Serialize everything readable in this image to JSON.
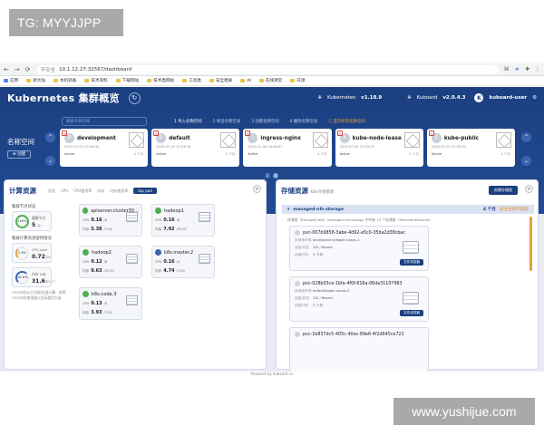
{
  "watermarks": {
    "top": "TG: MYYJJPP",
    "bottom": "www.yushijue.com"
  },
  "browser": {
    "insecure_label": "不安全",
    "url": "10.1.12.27:32567/dashboard",
    "bookmarks": [
      "应用",
      "新大陆",
      "本机装备",
      "技术资料",
      "下载网站",
      "技术类网站",
      "工具类",
      "安全相关",
      "AI",
      "在线课堂",
      "开源"
    ]
  },
  "app": {
    "title": "Kubernetes 集群概览",
    "kubernetes_label": "Kubernetes",
    "kubernetes_version": "v1.18.9",
    "kuboard_label": "Kuboard",
    "kuboard_version": "v2.0.4.3",
    "avatar_letter": "K",
    "user": "kuboard-user"
  },
  "toolbar": {
    "search_placeholder": "搜索名称空间",
    "steps": [
      "1 导入名称空间",
      "2 导出名称空间",
      "3 创建名称空间",
      "4 删除名称空间"
    ],
    "show_all": "显示所有名称空间"
  },
  "namespace": {
    "label": "名称空间",
    "new_button": "创建",
    "items": [
      {
        "letter": "D",
        "name": "development",
        "date": "2020-07-09 13:18:34",
        "status": "Active",
        "age": "4 个月"
      },
      {
        "letter": "D",
        "name": "default",
        "date": "2020-07-09 12:53:34",
        "status": "Active",
        "age": "4 个月"
      },
      {
        "letter": "I",
        "name": "ingress-nginx",
        "date": "2020-11-06 10:46:07",
        "status": "Active",
        "age": "4 个月"
      },
      {
        "letter": "K",
        "name": "kube-node-lease",
        "date": "2020-07-09 12:53:33",
        "status": "Active",
        "age": "4 个月"
      },
      {
        "letter": "K",
        "name": "kube-public",
        "date": "2020-07-09 12:53:33",
        "status": "Active",
        "age": "4 个月"
      }
    ],
    "pages": [
      "1",
      "2"
    ]
  },
  "compute": {
    "title": "计算资源",
    "tabs": [
      "总览",
      "CPU",
      "CPU使用率",
      "内存",
      "内存使用率",
      "top pod"
    ],
    "node_status_label": "集群节点状态",
    "alloc_label": "集群计算资源使用情况",
    "health": {
      "ring": "100%",
      "title": "健康节点",
      "value": "5",
      "unit": "台"
    },
    "cpu": {
      "ring": "2.6%",
      "title": "CPU core",
      "value": "0.72",
      "unit": "/28"
    },
    "mem": {
      "ring": "16.6%",
      "title": "内存 GiB",
      "value": "31.6",
      "unit": "/63.77"
    },
    "notes": [
      "CPU/内存以已分配/总量计算 · 说明",
      "CPU/内存使用量以实际使用为准"
    ],
    "cpu_label": "CPU",
    "mem_label": "内存",
    "nodes": [
      {
        "name": "apiserver.cluster30…",
        "cpu": "0.16",
        "cpu_total": "/4",
        "mem": "5.38",
        "mem_total": "/7.54"
      },
      {
        "name": "hadoop1",
        "cpu": "0.16",
        "cpu_total": "/8",
        "mem": "7.92",
        "mem_total": "/15.07"
      },
      {
        "name": "hadoop2",
        "cpu": "0.12",
        "cpu_total": "/8",
        "mem": "9.63",
        "mem_total": "/15.07"
      },
      {
        "name": "k8s.master.2",
        "cpu": "0.16",
        "cpu_total": "/4",
        "mem": "4.74",
        "mem_total": "/7.54"
      },
      {
        "name": "k8s.node.3",
        "cpu": "0.13",
        "cpu_total": "/4",
        "mem": "3.93",
        "mem_total": "/7.54"
      }
    ]
  },
  "storage": {
    "title": "存储资源",
    "subtitle": "K8s存储管理",
    "manage_button": "创建存储类",
    "class_name": "managed-nfs-storage",
    "class_count": "4 个月",
    "class_link": "前往查看存储类",
    "class_desc": "存储类（StorageClass）managed-nfs-storage 中共有 10 个存储卷（PersistentVolume）",
    "name_label": "存储卷声明",
    "cap_label": "容量/状态",
    "age_label": "创建时间",
    "btn_label": "文件浏览器",
    "pvcs": [
      {
        "name": "pvc-007b9858-3abe-4d92-a5c0-35ba2d38cbac",
        "ns": "development/logdir-nacos-1",
        "cap": "1Gi / Bound",
        "age": "3 个月"
      },
      {
        "name": "pvc-028b03ce-1bfa-4f0f-816a-06da31107983",
        "ns": "default/logdir-nacos-0",
        "cap": "1Gi / Bound",
        "age": "2 个月"
      },
      {
        "name": "pvc-1b837dc5-405c-40ec-89e6-4f2d645ce723",
        "ns": "",
        "cap": "",
        "age": ""
      }
    ]
  },
  "footer": "Powered by Kuboard.cn"
}
